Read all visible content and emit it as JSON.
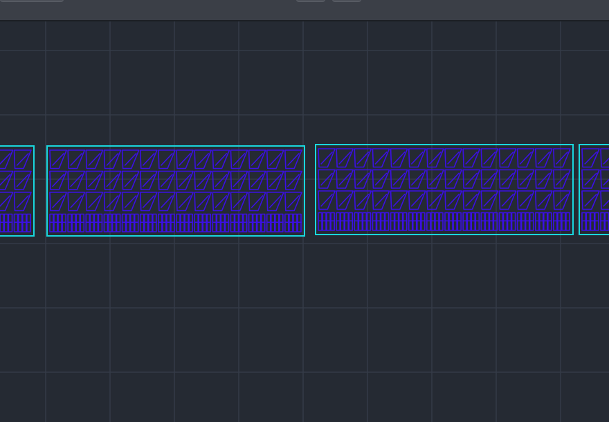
{
  "window": {
    "title": ""
  },
  "toolbar": {
    "buttons": [
      {
        "icon": "toolbar-button",
        "label": ""
      },
      {
        "icon": "toolbar-button",
        "label": ""
      },
      {
        "icon": "toolbar-button",
        "label": ""
      }
    ]
  },
  "canvas": {
    "background_color": "#252a33",
    "grid_color": "#343b48",
    "frame_color": "#19d7de",
    "geometry_color": "#3b0fe6",
    "nest_sheets": [
      {
        "id": "sheet-partial-left",
        "rows": 4,
        "cols": 2
      },
      {
        "id": "sheet-1",
        "rows": 4,
        "cols": 14
      },
      {
        "id": "sheet-2",
        "rows": 4,
        "cols": 14
      },
      {
        "id": "sheet-partial-right",
        "rows": 4,
        "cols": 2
      }
    ]
  }
}
